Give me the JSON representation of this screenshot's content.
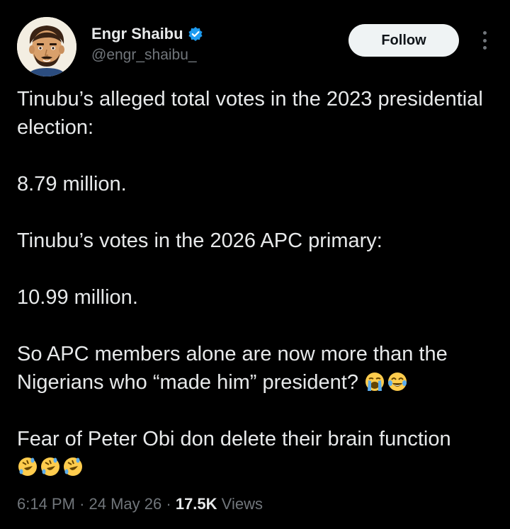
{
  "author": {
    "display_name": "Engr Shaibu",
    "handle": "@engr_shaibu_",
    "verified": true,
    "avatar_icon": "cartoon-man-avatar-icon"
  },
  "actions": {
    "follow_label": "Follow",
    "more_icon": "more-vertical-icon"
  },
  "tweet": {
    "paragraphs": [
      "Tinubu’s alleged total votes in the 2023 presidential election:",
      "8.79 million.",
      "Tinubu’s votes in the 2026 APC primary:",
      "10.99 million.",
      "So APC members alone are now more than the Nigerians who “made him” president?",
      "Fear of Peter Obi don delete their brain function"
    ],
    "emoji_after_p5": [
      "loudly-crying-face-emoji",
      "tears-of-joy-emoji"
    ],
    "emoji_after_p6": [
      "rolling-on-floor-laughing-emoji",
      "rolling-on-floor-laughing-emoji",
      "rolling-on-floor-laughing-emoji"
    ]
  },
  "meta": {
    "time": "6:14 PM",
    "separator": "·",
    "date": "24 May 26",
    "views_count": "17.5K",
    "views_label": "Views"
  },
  "colors": {
    "background": "#000000",
    "text_primary": "#e7e9ea",
    "text_secondary": "#71767b",
    "verified_blue": "#1d9bf0",
    "follow_bg": "#eff3f4"
  }
}
